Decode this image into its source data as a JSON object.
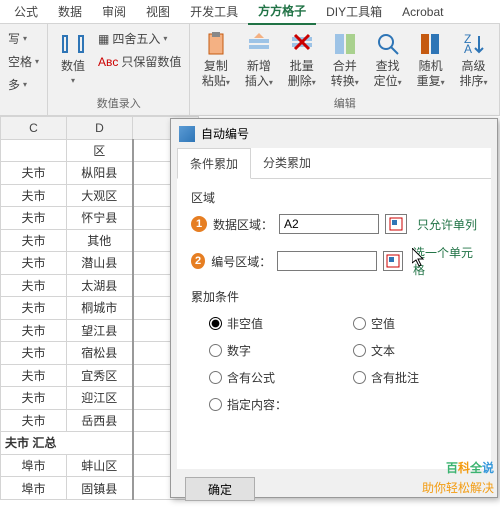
{
  "tabs": {
    "t0": "公式",
    "t1": "数据",
    "t2": "审阅",
    "t3": "视图",
    "t4": "开发工具",
    "t5": "方方格子",
    "t6": "DIY工具箱",
    "t7": "Acrobat"
  },
  "ribbon": {
    "g1_btn1": "写",
    "g1_opt1": "空格",
    "g1_opt2": "多",
    "g2_btn": "数值",
    "g2_opt1": "四舍五入",
    "g2_opt2": "只保留数值",
    "g2_label": "数值录入",
    "g3_copy": "复制粘贴",
    "g3_insert": "新增插入",
    "g3_del": "批量删除",
    "g3_merge": "合并转换",
    "g3_find": "查找定位",
    "g3_rand": "随机重复",
    "g3_sort": "高级排序",
    "g3_label": "编辑"
  },
  "sheet": {
    "colC": "C",
    "colD": "D",
    "d1": "区",
    "c2": "夫市",
    "d2": "枞阳县",
    "c3": "夫市",
    "d3": "大观区",
    "c4": "夫市",
    "d4": "怀宁县",
    "c5": "夫市",
    "d5": "其他",
    "c6": "夫市",
    "d6": "潜山县",
    "c7": "夫市",
    "d7": "太湖县",
    "c8": "夫市",
    "d8": "桐城市",
    "c9": "夫市",
    "d9": "望江县",
    "c10": "夫市",
    "d10": "宿松县",
    "c11": "夫市",
    "d11": "宜秀区",
    "c12": "夫市",
    "d12": "迎江区",
    "c13": "夫市",
    "d13": "岳西县",
    "c14": "夫市 汇总",
    "c15": "埠市",
    "d15": "蚌山区",
    "c16": "埠市",
    "d16": "固镇县"
  },
  "dialog": {
    "title": "自动编号",
    "tab1": "条件累加",
    "tab2": "分类累加",
    "sec1": "区域",
    "lbl1": "数据区域：",
    "val1": "A2",
    "hint1": "只允许单列",
    "lbl2": "编号区域：",
    "val2": "",
    "hint2": "选一个单元格",
    "sec2": "累加条件",
    "r1": "非空值",
    "r2": "空值",
    "r3": "数字",
    "r4": "文本",
    "r5": "含有公式",
    "r6": "含有批注",
    "r7": "指定内容：",
    "ok": "确定"
  },
  "watermark": {
    "big1": "百",
    "big2": "科",
    "big3": "全",
    "big4": "说",
    "small": "助你轻松解决"
  }
}
